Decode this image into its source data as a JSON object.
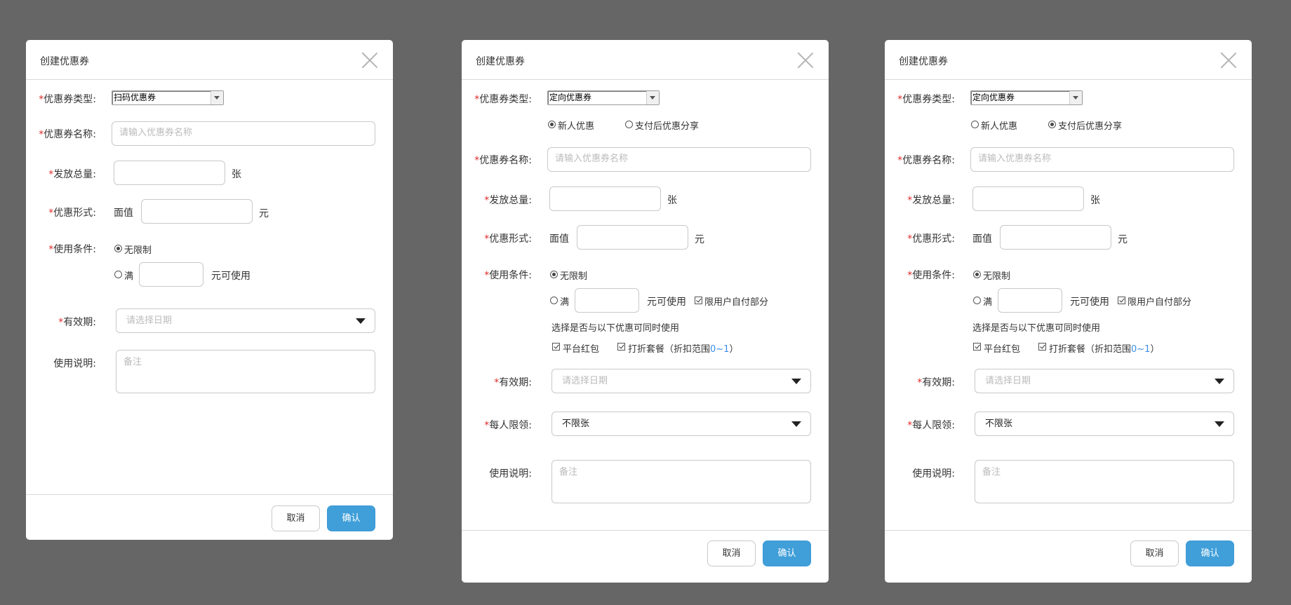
{
  "dialogs": [
    {
      "title": "创建优惠券",
      "required_mark": "*",
      "labels": {
        "type": "优惠券类型:",
        "name": "优惠券名称:",
        "total": "发放总量:",
        "form": "优惠形式:",
        "condition": "使用条件:",
        "validity": "有效期:",
        "desc": "使用说明:"
      },
      "coupon_type_value": "扫码优惠券",
      "name_placeholder": "请输入优惠券名称",
      "total_unit": "张",
      "form_prefix": "面值",
      "form_unit": "元",
      "condition_unlimited": "无限制",
      "condition_full": "满",
      "condition_usable": "元可使用",
      "validity_placeholder": "请选择日期",
      "desc_placeholder": "备注",
      "cancel": "取消",
      "confirm": "确认"
    },
    {
      "title": "创建优惠券",
      "required_mark": "*",
      "labels": {
        "type": "优惠券类型:",
        "name": "优惠券名称:",
        "total": "发放总量:",
        "form": "优惠形式:",
        "condition": "使用条件:",
        "validity": "有效期:",
        "limit": "每人限领:",
        "desc": "使用说明:"
      },
      "coupon_type_value": "定向优惠券",
      "sub_options": [
        "新人优惠",
        "支付后优惠分享"
      ],
      "selected_sub_option": "新人优惠",
      "name_placeholder": "请输入优惠券名称",
      "total_unit": "张",
      "form_prefix": "面值",
      "form_unit": "元",
      "condition_unlimited": "无限制",
      "condition_full": "满",
      "condition_usable": "元可使用",
      "self_pay_only": "限用户自付部分",
      "combine_hint": "选择是否与以下优惠可同时使用",
      "combine_red_packet": "平台红包",
      "combine_discount_prefix": "打折套餐（折扣范围",
      "combine_discount_range": "0~1",
      "combine_discount_suffix": "）",
      "validity_placeholder": "请选择日期",
      "limit_value": "不限张",
      "desc_placeholder": "备注",
      "cancel": "取消",
      "confirm": "确认"
    },
    {
      "title": "创建优惠券",
      "required_mark": "*",
      "labels": {
        "type": "优惠券类型:",
        "name": "优惠券名称:",
        "total": "发放总量:",
        "form": "优惠形式:",
        "condition": "使用条件:",
        "validity": "有效期:",
        "limit": "每人限领:",
        "desc": "使用说明:"
      },
      "coupon_type_value": "定向优惠券",
      "sub_options": [
        "新人优惠",
        "支付后优惠分享"
      ],
      "selected_sub_option": "支付后优惠分享",
      "name_placeholder": "请输入优惠券名称",
      "total_unit": "张",
      "form_prefix": "面值",
      "form_unit": "元",
      "condition_unlimited": "无限制",
      "condition_full": "满",
      "condition_usable": "元可使用",
      "self_pay_only": "限用户自付部分",
      "combine_hint": "选择是否与以下优惠可同时使用",
      "combine_red_packet": "平台红包",
      "combine_discount_prefix": "打折套餐（折扣范围",
      "combine_discount_range": "0~1",
      "combine_discount_suffix": "）",
      "validity_placeholder": "请选择日期",
      "limit_value": "不限张",
      "desc_placeholder": "备注",
      "cancel": "取消",
      "confirm": "确认"
    }
  ],
  "colors": {
    "backdrop": "#666666",
    "required": "#e02b2b",
    "primary_button": "#409fd9",
    "link": "#3a8ee6"
  }
}
